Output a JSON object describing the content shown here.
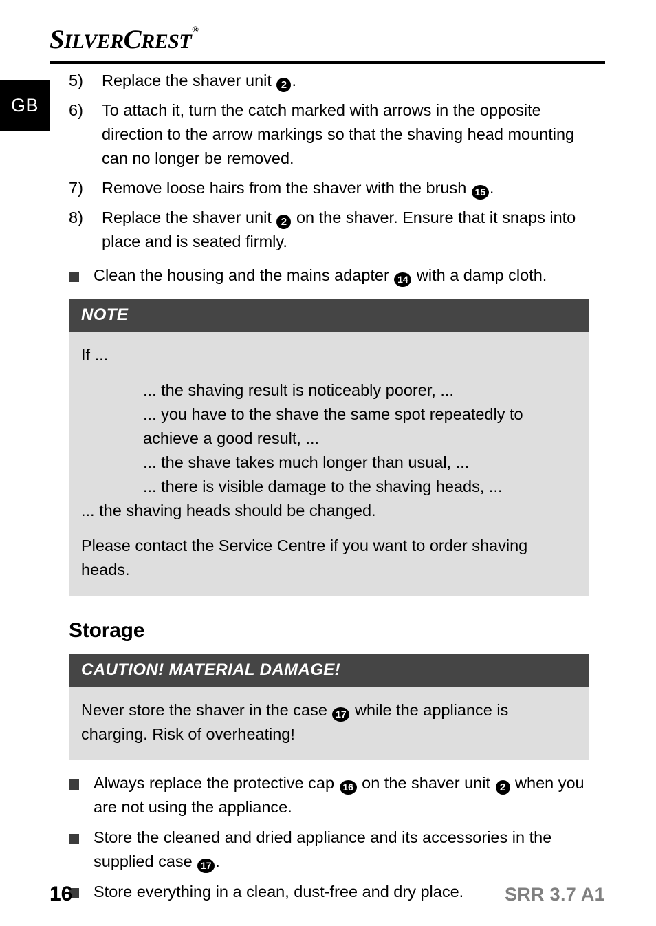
{
  "brand": {
    "name_part1": "S",
    "name_part2": "ILVER",
    "name_part3": "C",
    "name_part4": "REST",
    "registered_symbol": "®"
  },
  "language_tab": {
    "label": "GB"
  },
  "steps": [
    {
      "marker": "5)",
      "segments": [
        {
          "type": "text",
          "value": "Replace the shaver unit "
        },
        {
          "type": "circled",
          "value": "2"
        },
        {
          "type": "text",
          "value": "."
        }
      ],
      "plain": "Replace the shaver unit 2."
    },
    {
      "marker": "6)",
      "segments": [
        {
          "type": "text",
          "value": "To attach it, turn the catch marked with arrows in the opposite direction to the arrow markings so that the shaving head mounting can no longer be removed."
        }
      ],
      "plain": "To attach it, turn the catch marked with arrows in the opposite direction to the arrow markings so that the shaving head mounting can no longer be removed."
    },
    {
      "marker": "7)",
      "segments": [
        {
          "type": "text",
          "value": "Remove loose hairs from the shaver with the brush "
        },
        {
          "type": "circled",
          "value": "15"
        },
        {
          "type": "text",
          "value": "."
        }
      ],
      "plain": "Remove loose hairs from the shaver with the brush 15."
    },
    {
      "marker": "8)",
      "segments": [
        {
          "type": "text",
          "value": "Replace the shaver unit "
        },
        {
          "type": "circled",
          "value": "2"
        },
        {
          "type": "text",
          "value": " on the shaver. Ensure that it snaps into place and is seated firmly."
        }
      ],
      "plain": "Replace the shaver unit 2 on the shaver. Ensure that it snaps into place and is seated firmly."
    }
  ],
  "clean_bullet": {
    "text_before": "Clean the housing and the mains adapter ",
    "circled": "14",
    "text_after": " with a damp cloth."
  },
  "note_box": {
    "heading": "NOTE",
    "intro": "If ...",
    "conditions": [
      "... the shaving result is noticeably poorer, ...",
      "... you have to the shave the same spot repeatedly to achieve a good result, ...",
      "... the shave takes much longer than usual, ...",
      "... there is visible damage to the shaving heads, ..."
    ],
    "conclusion": "... the shaving heads should be changed.",
    "service": "Please contact the Service Centre if you want to order shaving heads."
  },
  "storage_section": {
    "heading": "Storage"
  },
  "caution_box": {
    "heading": "CAUTION! MATERIAL DAMAGE!",
    "text_before": "Never store the shaver in the case ",
    "circled": "17",
    "text_after": " while the appliance is charging. Risk of overheating!"
  },
  "storage_bullets": [
    {
      "segments": [
        {
          "type": "text",
          "value": "Always replace the protective cap "
        },
        {
          "type": "circled",
          "value": "16"
        },
        {
          "type": "text",
          "value": " on the shaver unit "
        },
        {
          "type": "circled",
          "value": "2"
        },
        {
          "type": "text",
          "value": " when you are not using the appliance."
        }
      ],
      "plain": "Always replace the protective cap 16 on the shaver unit 2 when you are not using the appliance."
    },
    {
      "segments": [
        {
          "type": "text",
          "value": "Store the cleaned and dried appliance and its accessories in the supplied case "
        },
        {
          "type": "circled",
          "value": "17"
        },
        {
          "type": "text",
          "value": "."
        }
      ],
      "plain": "Store the cleaned and dried appliance and its accessories in the supplied case 17."
    },
    {
      "segments": [
        {
          "type": "text",
          "value": "Store everything in a clean, dust-free and dry place."
        }
      ],
      "plain": "Store everything in a clean, dust-free and dry place."
    }
  ],
  "footer": {
    "page_number": "16",
    "model": "SRR 3.7 A1"
  },
  "colors": {
    "callout_header_bg": "#454545",
    "callout_body_bg": "#dedede",
    "bullet_square": "#3c3c3c",
    "footer_model": "#808080",
    "lang_tab_bg": "#000000"
  }
}
